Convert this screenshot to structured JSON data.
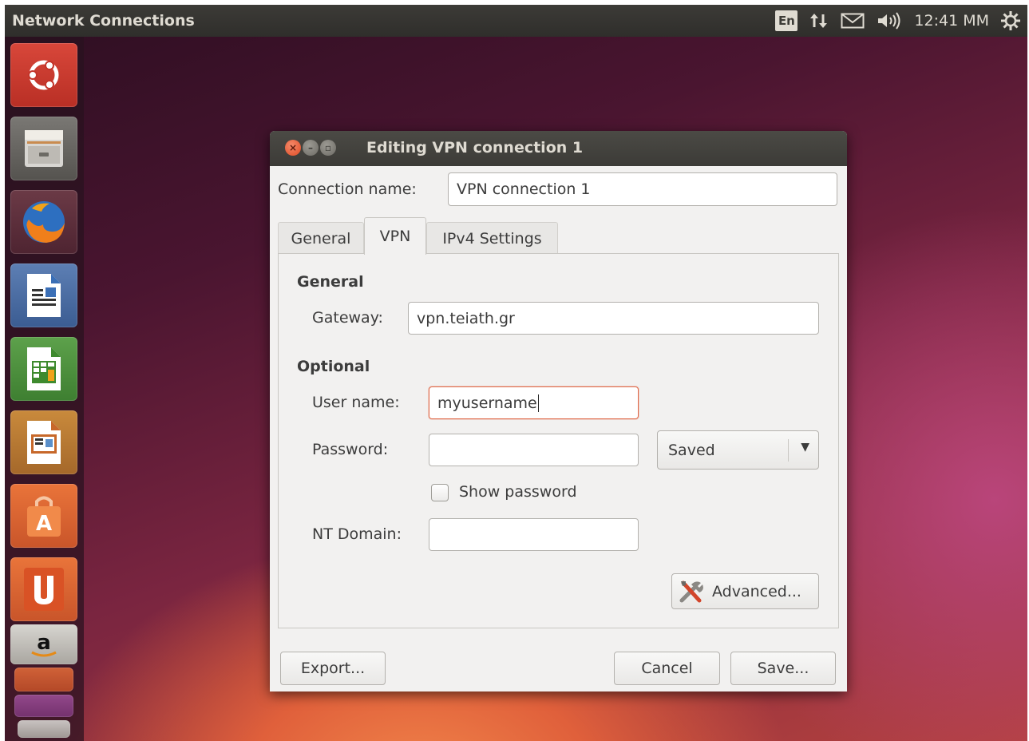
{
  "panel": {
    "title": "Network Connections",
    "language": "En",
    "clock": "12:41 MM",
    "icons": [
      "network-updown-icon",
      "mail-icon",
      "volume-icon",
      "power-gear-icon"
    ]
  },
  "launcher": {
    "items": [
      "ubuntu-dash-icon",
      "files-icon",
      "firefox-icon",
      "writer-icon",
      "calc-icon",
      "impress-icon",
      "software-center-icon",
      "ubuntu-one-icon",
      "amazon-icon"
    ]
  },
  "dialog": {
    "title": "Editing VPN connection 1",
    "connection_name_label": "Connection name:",
    "connection_name_value": "VPN connection 1",
    "tabs": [
      {
        "label": "General"
      },
      {
        "label": "VPN"
      },
      {
        "label": "IPv4 Settings"
      }
    ],
    "vpn": {
      "general_heading": "General",
      "gateway_label": "Gateway:",
      "gateway_value": "vpn.teiath.gr",
      "optional_heading": "Optional",
      "username_label": "User name:",
      "username_value": "myusername",
      "password_label": "Password:",
      "password_value": "",
      "password_mode": "Saved",
      "show_password_label": "Show password",
      "show_password_checked": false,
      "nt_domain_label": "NT Domain:",
      "nt_domain_value": "",
      "advanced_label": "Advanced..."
    },
    "buttons": {
      "export": "Export...",
      "cancel": "Cancel",
      "save": "Save..."
    }
  },
  "colors": {
    "accent": "#df4b25",
    "panel": "#3c3b37",
    "dialog_bg": "#f2f1f0"
  }
}
